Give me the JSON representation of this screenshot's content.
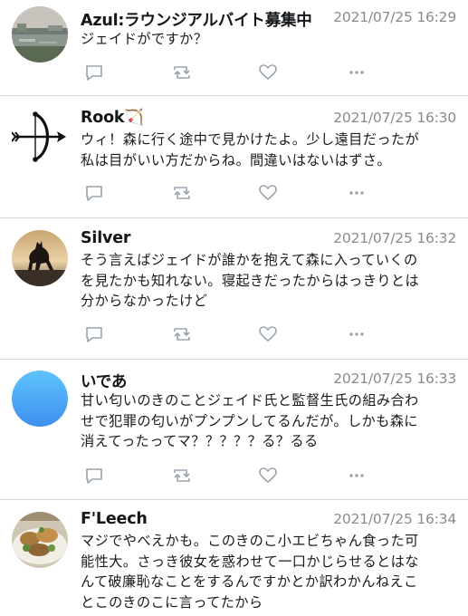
{
  "tweets": [
    {
      "author": "Azul:ラウンジアルバイト募集中",
      "timestamp": "2021/07/25 16:29",
      "lines": [
        "ジェイドがですか？"
      ],
      "avatar": "avatar-azul-lakeside-icon"
    },
    {
      "author": "Rook🏹",
      "timestamp": "2021/07/25 16:30",
      "lines": [
        "ウィ！森に行く途中で見かけたよ。少し遠目だったが",
        "私は目がいい方だからね。間違いはないはずさ。"
      ],
      "avatar": "avatar-rook-bow-arrow-icon"
    },
    {
      "author": "Silver",
      "timestamp": "2021/07/25 16:32",
      "lines": [
        "そう言えばジェイドが誰かを抱えて森に入っていくの",
        "を見たかも知れない。寝起きだったからはっきりとは",
        "分からなかったけど"
      ],
      "avatar": "avatar-silver-horse-icon"
    },
    {
      "author": "いであ",
      "timestamp": "2021/07/25 16:33",
      "lines": [
        "甘い匂いのきのことジェイド氏と監督生氏の組み合わ",
        "せで犯罪の匂いがプンプンしてるんだが。しかも森に",
        "消えてったってマ？？？？？る？るる"
      ],
      "avatar": "avatar-idea-blue-gradient-icon"
    },
    {
      "author": "F'Leech",
      "timestamp": "2021/07/25 16:34",
      "lines": [
        "マジでやべえかも。このきのこ小エビちゃん食った可",
        "能性大。さっき彼女を惑わせて一口かじらせるとはな",
        "んて破廉恥なことをするんですかとか訳わかんねえこ",
        "とこのきのこに言ってたから"
      ],
      "avatar": "avatar-fleech-food-plate-icon"
    }
  ],
  "icons": {
    "reply": "reply-bubble-icon",
    "retweet": "retweet-icon",
    "like": "heart-icon",
    "more": "more-dots-icon"
  },
  "colors": {
    "text": "#14171a",
    "meta": "#8a8a8a",
    "action": "#9aa3ab",
    "divider": "#d8d8d8",
    "avatar_blue": "#4aa8f5"
  }
}
